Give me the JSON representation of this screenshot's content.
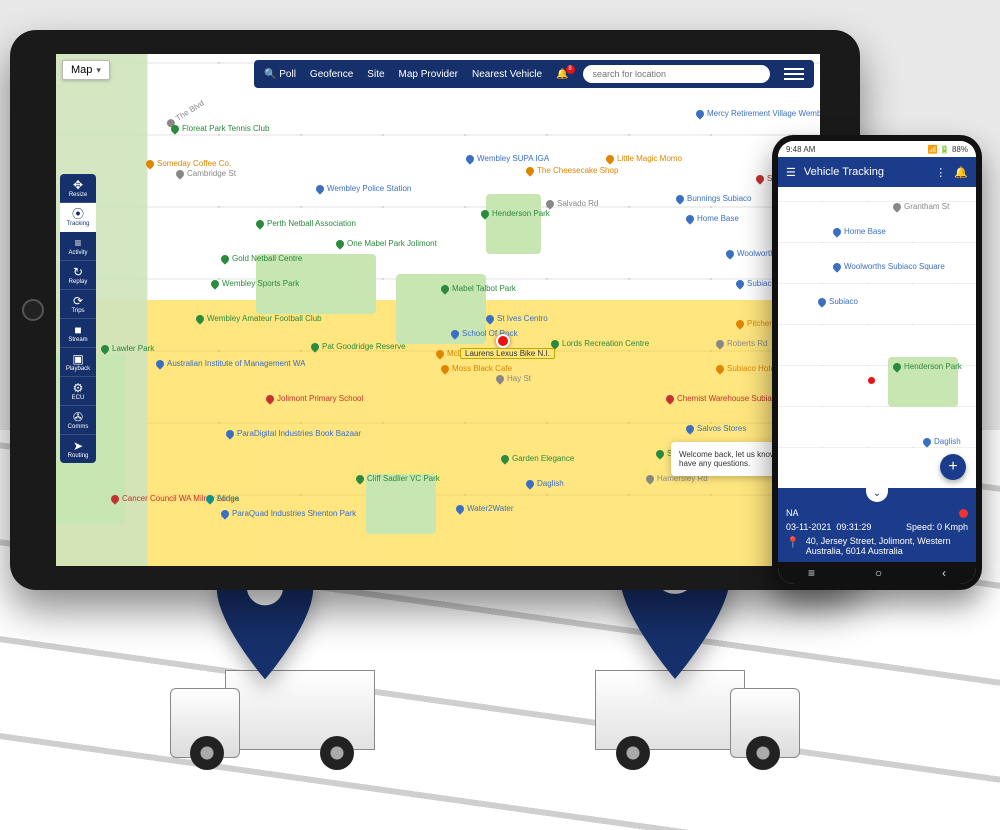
{
  "tablet": {
    "map_type_label": "Map",
    "topbar": {
      "poll": "Poll",
      "geofence": "Geofence",
      "site": "Site",
      "map_provider": "Map Provider",
      "nearest_vehicle": "Nearest Vehicle",
      "notification_count": "8",
      "search_placeholder": "search for location"
    },
    "sidebar": [
      {
        "icon": "✥",
        "label": "Resize"
      },
      {
        "icon": "⦿",
        "label": "Tracking"
      },
      {
        "icon": "≡",
        "label": "Activity"
      },
      {
        "icon": "↻",
        "label": "Replay"
      },
      {
        "icon": "⟳",
        "label": "Trips"
      },
      {
        "icon": "■",
        "label": "Stream"
      },
      {
        "icon": "▣",
        "label": "Playback"
      },
      {
        "icon": "⚙",
        "label": "ECU"
      },
      {
        "icon": "✇",
        "label": "Comms"
      },
      {
        "icon": "➤",
        "label": "Routing"
      }
    ],
    "vehicle_label": "Laurens Lexus Bike N.I.",
    "welcome_text": "Welcome back, let us know if you have any questions.",
    "pois": {
      "floreat_park": "Floreat Park Tennis Club",
      "someday_coffee": "Someday Coffee Co.",
      "wembley_police": "Wembley Police Station",
      "perth_netball": "Perth Netball Association",
      "gold_netball": "Gold Netball Centre",
      "wembley_sports": "Wembley Sports Park",
      "wembley_amateur": "Wembley Amateur Football Club",
      "aus_institute": "Australian Institute of Management WA",
      "lawler_park": "Lawler Park",
      "pat_goodridge": "Pat Goodridge Reserve",
      "jolimont_primary": "Jolimont Primary School",
      "paradigital": "ParaDigital Industries Book Bazaar",
      "cancer_council": "Cancer Council WA Milroy Lodge",
      "alinea": "Alinea",
      "paraquad": "ParaQuad Industries Shenton Park",
      "cliff_sadlier": "Cliff Sadlier VC Park",
      "mabel_talbot": "Mabel Talbot Park",
      "henderson_park": "Henderson Park",
      "one_mabel": "One Mabel Park Jolimont",
      "school_of_rock": "School Of Rock",
      "st_ives": "St Ives Centro",
      "mcdo": "McDo",
      "moss_black": "Moss Black Cafe",
      "lords_rec": "Lords Recreation Centre",
      "wembley_supa": "Wembley SUPA IGA",
      "cheesecake": "The Cheesecake Shop",
      "little_magic": "Little Magic Momo",
      "mercy_village": "Mercy Retirement Village Wembley",
      "home_base": "Home Base",
      "bunnings": "Bunnings Subiaco",
      "woolworths": "Woolworths Subiaco Square",
      "subiaco": "Subiaco",
      "pitcher": "Pitcher and Iron",
      "subiaco_hotel": "Subiaco Hotel",
      "chemist": "Chemist Warehouse Subiaco",
      "salvos": "Salvos Stores",
      "subi_farmers": "Subi Farmers Market",
      "garden_elegance": "Garden Elegance",
      "water2water": "Water2Water",
      "daglish": "Daglish",
      "st_john": "St John Subiaco"
    },
    "streets": {
      "cambridge": "Cambridge St",
      "salvado": "Salvado Rd",
      "hay": "Hay St",
      "the_blvd": "The Blvd",
      "grantham": "Grantham St",
      "roberts": "Roberts Rd",
      "hamersley": "Hamersley Rd"
    }
  },
  "phone": {
    "status_time": "9:48 AM",
    "status_right": "88%",
    "header_title": "Vehicle Tracking",
    "card": {
      "vehicle": "NA",
      "date": "03-11-2021",
      "time": "09:31:29",
      "speed": "Speed: 0 Kmph",
      "address": "40, Jersey Street, Jolimont, Western Australia, 6014 Australia"
    },
    "pois": {
      "home_base": "Home Base",
      "woolworths": "Woolworths Subiaco Square",
      "subiaco": "Subiaco",
      "henderson_park": "Henderson Park",
      "grantham": "Grantham St",
      "daglish": "Daglish"
    }
  }
}
